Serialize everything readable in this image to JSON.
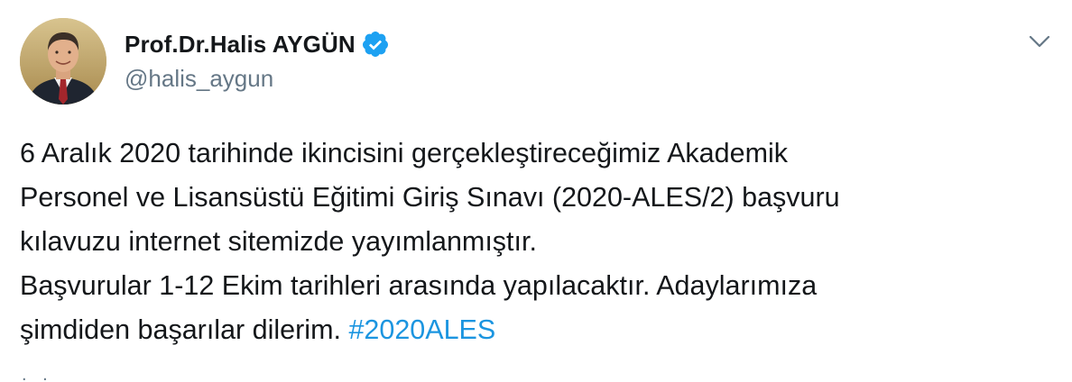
{
  "author": {
    "display_name": "Prof.Dr.Halis AYGÜN",
    "handle": "@halis_aygun",
    "verified_icon": "verified-badge-icon",
    "avatar": "profile-photo"
  },
  "tweet": {
    "lines": [
      "6 Aralık 2020 tarihinde ikincisini gerçekleştireceğimiz Akademik",
      "Personel ve Lisansüstü Eğitimi Giriş Sınavı (2020-ALES/2) başvuru",
      "kılavuzu internet sitemizde yayımlanmıştır.",
      "Başvurular 1-12 Ekim tarihleri arasında yapılacaktır. Adaylarımıza"
    ],
    "last_line_text": "şimdiden başarılar dilerim. ",
    "hashtag": "#2020ALES",
    "continuation": ". ."
  },
  "menu": {
    "icon": "chevron-down-icon"
  },
  "colors": {
    "text": "#14171a",
    "secondary": "#657786",
    "link": "#1b95e0",
    "verified": "#1da1f2"
  }
}
